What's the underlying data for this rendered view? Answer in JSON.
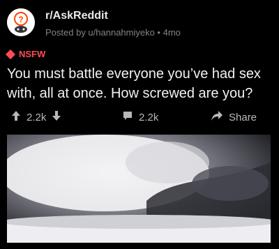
{
  "post": {
    "subreddit": "r/AskReddit",
    "meta": "Posted by u/hannahmiyeko • 4mo",
    "nsfw_label": "NSFW",
    "title": "You must battle everyone you’ve had sex with, all at once. How screwed are you?",
    "upvotes": "2.2k",
    "comments": "2.2k",
    "share_label": "Share"
  },
  "colors": {
    "background": "#000000",
    "nsfw": "#ff4a57",
    "text": "#f1f1f1",
    "meta": "#818384",
    "action": "#b6b8ba"
  },
  "icons": {
    "avatar": "askreddit-logo",
    "nsfw": "diamond-icon",
    "upvote": "arrow-up-icon",
    "downvote": "arrow-down-icon",
    "comment": "comment-icon",
    "share": "share-arrow-icon"
  }
}
